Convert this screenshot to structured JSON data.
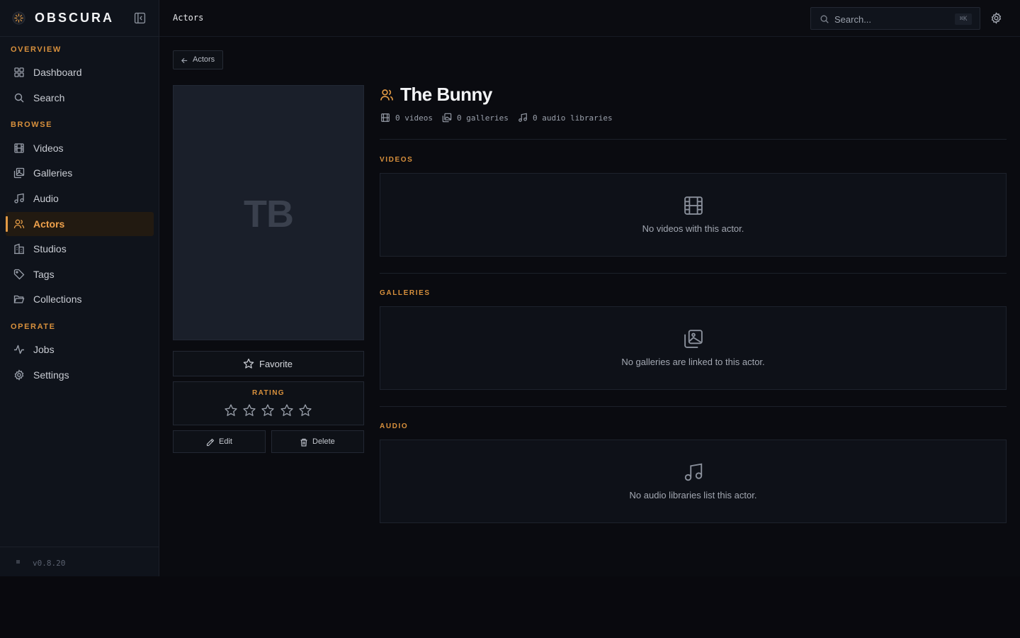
{
  "brand": {
    "name": "OBSCURA",
    "version": "v0.8.20"
  },
  "sidebar": {
    "sections": [
      {
        "label": "OVERVIEW"
      },
      {
        "label": "BROWSE"
      },
      {
        "label": "OPERATE"
      }
    ],
    "items": [
      {
        "label": "Dashboard",
        "icon": "dashboard-icon"
      },
      {
        "label": "Search",
        "icon": "search-icon"
      },
      {
        "label": "Videos",
        "icon": "film-icon"
      },
      {
        "label": "Galleries",
        "icon": "gallery-icon"
      },
      {
        "label": "Audio",
        "icon": "music-note-icon"
      },
      {
        "label": "Actors",
        "icon": "users-icon",
        "active": true
      },
      {
        "label": "Studios",
        "icon": "building-icon"
      },
      {
        "label": "Tags",
        "icon": "tag-icon"
      },
      {
        "label": "Collections",
        "icon": "folder-icon"
      },
      {
        "label": "Jobs",
        "icon": "activity-icon"
      },
      {
        "label": "Settings",
        "icon": "gear-icon"
      }
    ]
  },
  "topbar": {
    "title": "Actors",
    "search_placeholder": "Search...",
    "shortcut": "⌘K"
  },
  "main": {
    "back_label": "Actors",
    "actor": {
      "name": "The Bunny",
      "initials": "TB",
      "stats": {
        "videos": "0 videos",
        "galleries": "0 galleries",
        "audio": "0 audio libraries"
      }
    },
    "favorite_label": "Favorite",
    "rating": {
      "label": "RATING",
      "value": 0,
      "max": 5
    },
    "edit_label": "Edit",
    "delete_label": "Delete",
    "sections": {
      "videos": {
        "title": "VIDEOS",
        "empty": "No videos with this actor."
      },
      "galleries": {
        "title": "GALLERIES",
        "empty": "No galleries are linked to this actor."
      },
      "audio": {
        "title": "AUDIO",
        "empty": "No audio libraries list this actor."
      }
    }
  },
  "colors": {
    "accent": "#e29a45",
    "background": "#0a0b10",
    "sidebar": "#0f131b",
    "text": "#d6d8de"
  }
}
